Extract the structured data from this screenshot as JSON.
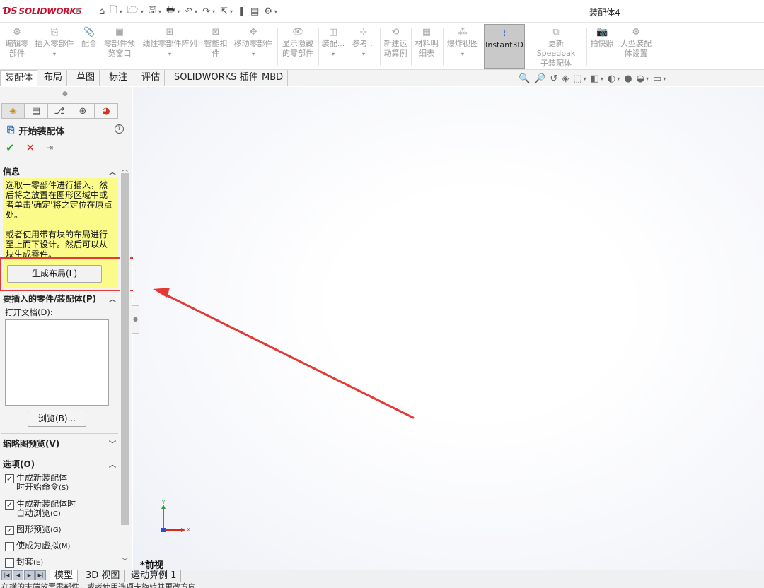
{
  "app": {
    "brand": "SOLIDWORKS",
    "document_title": "装配体4"
  },
  "quick_access": {
    "icons": [
      "home-icon",
      "new-icon",
      "open-icon",
      "save-icon",
      "print-icon",
      "undo-icon",
      "redo-icon",
      "select-icon",
      "rebuild-icon",
      "file-properties-icon",
      "options-icon"
    ]
  },
  "ribbon": {
    "buttons": [
      {
        "label": "编辑零\n部件",
        "icon": "edit-component-icon"
      },
      {
        "label": "插入零部件",
        "icon": "insert-component-icon"
      },
      {
        "label": "配合",
        "icon": "mate-icon"
      },
      {
        "label": "零部件预\n览窗口",
        "icon": "component-preview-icon"
      },
      {
        "label": "线性零部件阵列",
        "icon": "linear-pattern-icon"
      },
      {
        "label": "智能扣\n件",
        "icon": "smart-fasteners-icon"
      },
      {
        "label": "移动零部件",
        "icon": "move-component-icon"
      },
      {
        "label": "显示隐藏\n的零部件",
        "icon": "show-hidden-icon"
      },
      {
        "label": "装配...",
        "icon": "assembly-features-icon"
      },
      {
        "label": "参考...",
        "icon": "reference-geometry-icon"
      },
      {
        "label": "新建运\n动算例",
        "icon": "new-motion-study-icon"
      },
      {
        "label": "材料明\n细表",
        "icon": "bom-icon"
      },
      {
        "label": "爆炸视图",
        "icon": "exploded-view-icon"
      },
      {
        "label": "Instant3D",
        "icon": "instant3d-icon"
      },
      {
        "label": "更新 Speedpak\n子装配体",
        "icon": "speedpak-icon"
      },
      {
        "label": "拍快照",
        "icon": "snapshot-icon"
      },
      {
        "label": "大型装配\n体设置",
        "icon": "large-assembly-icon"
      }
    ]
  },
  "tabs": [
    "装配体",
    "布局",
    "草图",
    "标注",
    "评估",
    "SOLIDWORKS 插件",
    "MBD"
  ],
  "active_tab": "装配体",
  "panel": {
    "title": "开始装配体",
    "info_header": "信息",
    "info_text_1": "选取一零部件进行插入，然后将之放置在图形区域中或者单击'确定'将之定位在原点处。",
    "info_text_2": "或者使用带有块的布局进行至上而下设计。然后可以从块生成零件。",
    "create_layout_button": "生成布局(L)",
    "insert_header": "要插入的零件/装配体(P)",
    "open_docs_label": "打开文档(D):",
    "browse_button": "浏览(B)...",
    "thumbnail_header": "缩略图预览(V)",
    "options_header": "选项(O)",
    "options": [
      {
        "line1": "生成新装配体",
        "line2": "时开始命令",
        "shortcut": "(S)",
        "checked": true
      },
      {
        "line1": "生成新装配体时",
        "line2": "自动浏览",
        "shortcut": "(C)",
        "checked": true
      },
      {
        "line1": "图形预览",
        "line2": "",
        "shortcut": "(G)",
        "checked": true
      },
      {
        "line1": "使成为虚拟",
        "line2": "",
        "shortcut": "(M)",
        "checked": false
      },
      {
        "line1": "封套",
        "line2": "",
        "shortcut": "(E)",
        "checked": false
      }
    ]
  },
  "viewport": {
    "view_name": "*前视",
    "triad_x": "X",
    "triad_y": "Y"
  },
  "bottom_tabs": [
    "模型",
    "3D 视图",
    "运动算例 1"
  ],
  "status_text": "在横的末端放置零部件，或者使用选项卡旋转并更改方向"
}
